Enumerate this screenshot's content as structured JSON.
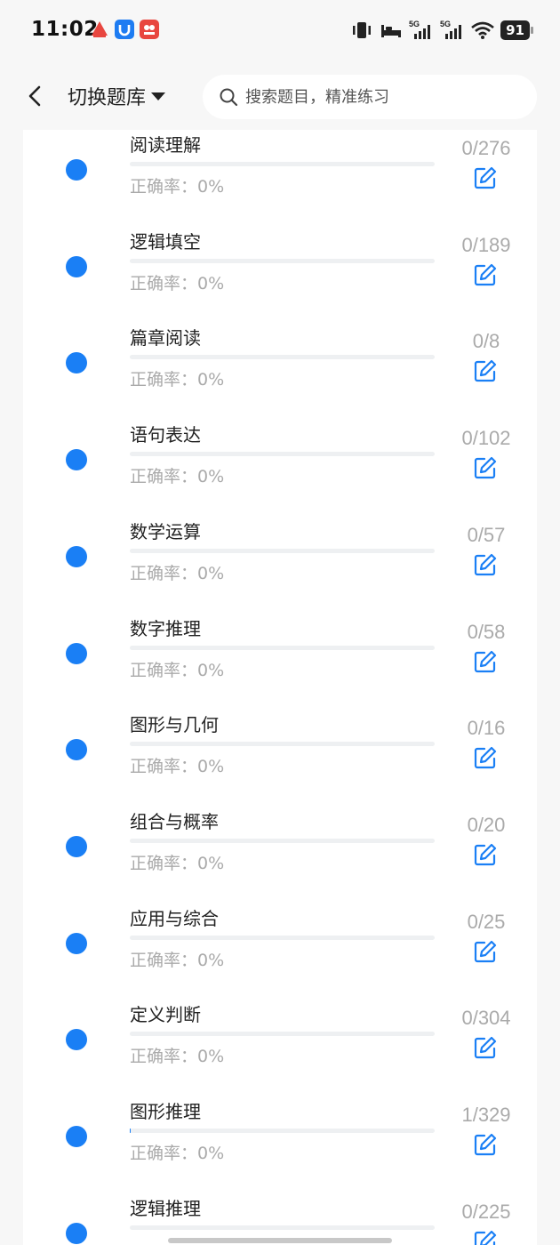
{
  "status_bar": {
    "time": "11:02",
    "network": [
      "5G",
      "5G"
    ],
    "battery": "91"
  },
  "header": {
    "bank_switch_label": "切换题库",
    "search_placeholder": "搜索题目，精准练习"
  },
  "accent_color": "#1a7ff5",
  "items": [
    {
      "title": "阅读理解",
      "accuracy": "正确率：0%",
      "progress": "0/276",
      "done_fraction": 0
    },
    {
      "title": "逻辑填空",
      "accuracy": "正确率：0%",
      "progress": "0/189",
      "done_fraction": 0
    },
    {
      "title": "篇章阅读",
      "accuracy": "正确率：0%",
      "progress": "0/8",
      "done_fraction": 0
    },
    {
      "title": "语句表达",
      "accuracy": "正确率：0%",
      "progress": "0/102",
      "done_fraction": 0
    },
    {
      "title": "数学运算",
      "accuracy": "正确率：0%",
      "progress": "0/57",
      "done_fraction": 0
    },
    {
      "title": "数字推理",
      "accuracy": "正确率：0%",
      "progress": "0/58",
      "done_fraction": 0
    },
    {
      "title": "图形与几何",
      "accuracy": "正确率：0%",
      "progress": "0/16",
      "done_fraction": 0
    },
    {
      "title": "组合与概率",
      "accuracy": "正确率：0%",
      "progress": "0/20",
      "done_fraction": 0
    },
    {
      "title": "应用与综合",
      "accuracy": "正确率：0%",
      "progress": "0/25",
      "done_fraction": 0
    },
    {
      "title": "定义判断",
      "accuracy": "正确率：0%",
      "progress": "0/304",
      "done_fraction": 0
    },
    {
      "title": "图形推理",
      "accuracy": "正确率：0%",
      "progress": "1/329",
      "done_fraction": 0.003
    },
    {
      "title": "逻辑推理",
      "accuracy": "",
      "progress": "0/225",
      "done_fraction": 0
    }
  ]
}
